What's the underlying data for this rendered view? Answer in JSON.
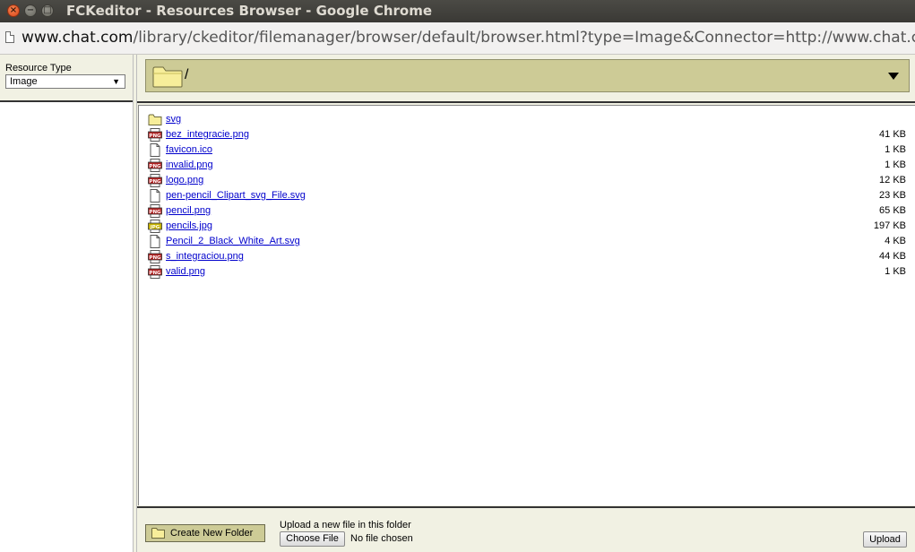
{
  "window": {
    "title": "FCKeditor - Resources Browser - Google Chrome",
    "close_glyph": "×",
    "min_glyph": "−",
    "max_glyph": "□"
  },
  "address_bar": {
    "host": "www.chat.com",
    "path": "/library/ckeditor/filemanager/browser/default/browser.html?type=Image&Connector=http://www.chat.com/library/ckeditor/fi"
  },
  "resource_type": {
    "label": "Resource Type",
    "selected": "Image"
  },
  "folder_bar": {
    "path": "/",
    "icon": "folder-icon"
  },
  "files": [
    {
      "name": "svg",
      "size": "",
      "icon": "folder"
    },
    {
      "name": "bez_integracie.png",
      "size": "41 KB",
      "icon": "png"
    },
    {
      "name": "favicon.ico",
      "size": "1 KB",
      "icon": "generic"
    },
    {
      "name": "invalid.png",
      "size": "1 KB",
      "icon": "png"
    },
    {
      "name": "logo.png",
      "size": "12 KB",
      "icon": "png"
    },
    {
      "name": "pen-pencil_Clipart_svg_File.svg",
      "size": "23 KB",
      "icon": "generic"
    },
    {
      "name": "pencil.png",
      "size": "65 KB",
      "icon": "png"
    },
    {
      "name": "pencils.jpg",
      "size": "197 KB",
      "icon": "jpg"
    },
    {
      "name": "Pencil_2_Black_White_Art.svg",
      "size": "4 KB",
      "icon": "generic"
    },
    {
      "name": "s_integraciou.png",
      "size": "44 KB",
      "icon": "png"
    },
    {
      "name": "valid.png",
      "size": "1 KB",
      "icon": "png"
    }
  ],
  "icon_labels": {
    "png": "PNG",
    "jpg": "JPG"
  },
  "bottom": {
    "create_folder_label": "Create New Folder",
    "upload_label": "Upload a new file in this folder",
    "choose_file_label": "Choose File",
    "no_file_text": "No file chosen",
    "upload_button_label": "Upload"
  },
  "colors": {
    "panel_bg": "#f1f1e3",
    "folder_bar_bg": "#cdcb96",
    "link": "#0000cc",
    "png_icon": "#b22222",
    "jpg_icon": "#c8b400"
  }
}
